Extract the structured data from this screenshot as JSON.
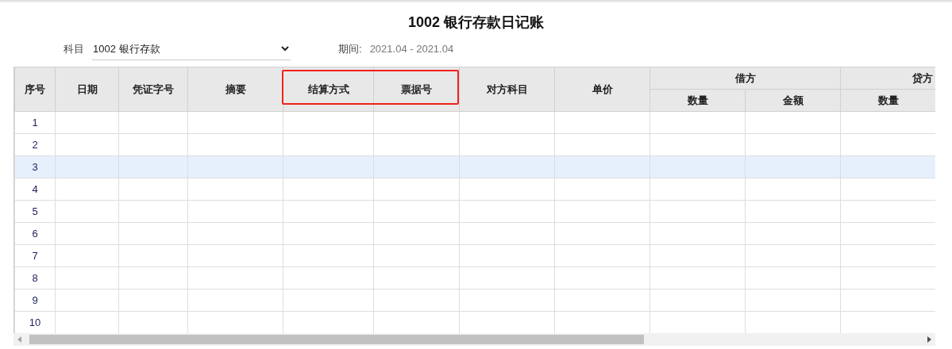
{
  "title": "1002 银行存款日记账",
  "filters": {
    "subject_label": "科目",
    "subject_value": "1002 银行存款",
    "period_label": "期间:",
    "period_value": "2021.04 - 2021.04"
  },
  "table": {
    "columns": [
      {
        "label": "序号",
        "highlighted": false
      },
      {
        "label": "日期",
        "highlighted": false
      },
      {
        "label": "凭证字号",
        "highlighted": false
      },
      {
        "label": "摘要",
        "highlighted": false
      },
      {
        "label": "结算方式",
        "highlighted": true
      },
      {
        "label": "票据号",
        "highlighted": true
      },
      {
        "label": "对方科目",
        "highlighted": false
      },
      {
        "label": "单价",
        "highlighted": false
      },
      {
        "label": "借方",
        "highlighted": false,
        "children": [
          {
            "label": "数量"
          },
          {
            "label": "金额"
          }
        ]
      },
      {
        "label": "贷方",
        "highlighted": false,
        "children": [
          {
            "label": "数量"
          }
        ]
      }
    ],
    "rows": [
      {
        "number": "1",
        "selected": false
      },
      {
        "number": "2",
        "selected": false
      },
      {
        "number": "3",
        "selected": true
      },
      {
        "number": "4",
        "selected": false
      },
      {
        "number": "5",
        "selected": false
      },
      {
        "number": "6",
        "selected": false
      },
      {
        "number": "7",
        "selected": false
      },
      {
        "number": "8",
        "selected": false
      },
      {
        "number": "9",
        "selected": false
      },
      {
        "number": "10",
        "selected": false
      }
    ]
  }
}
